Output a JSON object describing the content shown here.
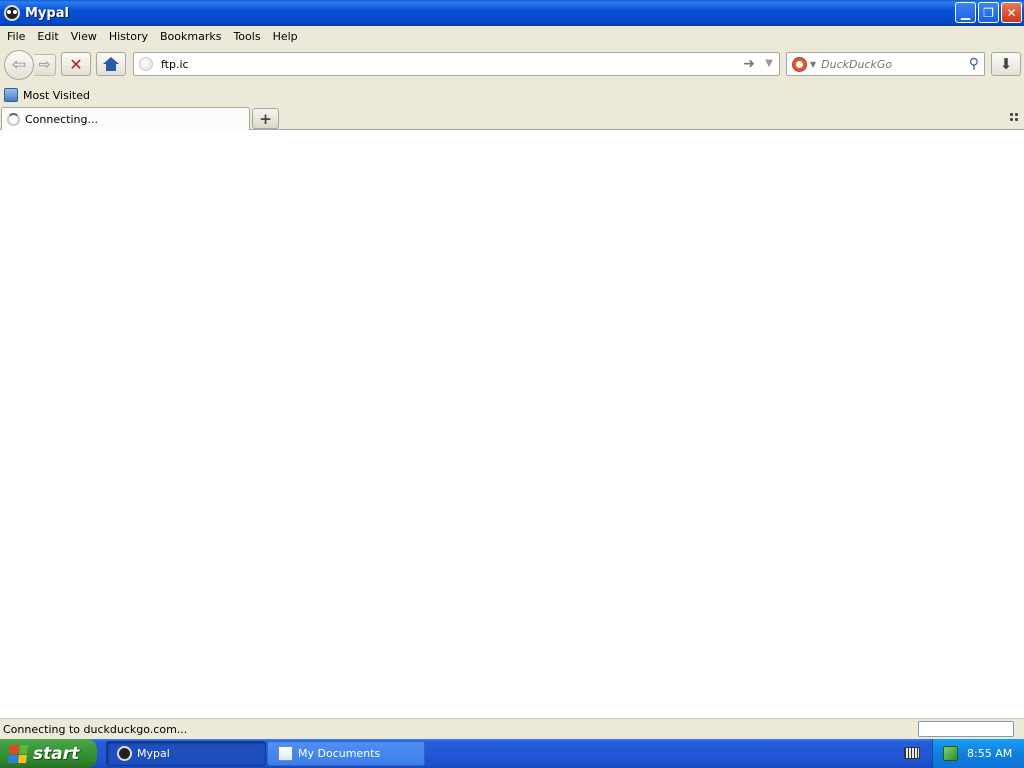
{
  "window": {
    "title": "Mypal",
    "controls": [
      "minimize",
      "restore",
      "close"
    ]
  },
  "menu": [
    "File",
    "Edit",
    "View",
    "History",
    "Bookmarks",
    "Tools",
    "Help"
  ],
  "toolbar": {
    "back_icon": "back-arrow-icon",
    "forward_icon": "forward-arrow-icon",
    "stop_label": "✕",
    "url_value": "ftp.ic",
    "search_placeholder": "DuckDuckGo"
  },
  "bookmarks": {
    "items": [
      "Most Visited"
    ]
  },
  "tabs": [
    {
      "label": "Connecting...",
      "state": "loading"
    }
  ],
  "status": {
    "text": "Connecting to duckduckgo.com..."
  },
  "taskbar": {
    "start_label": "start",
    "tasks": [
      "Mypal",
      "My Documents"
    ],
    "clock": "8:55 AM"
  },
  "colors": {
    "title_bar": "#0753d4",
    "chrome": "#ece9d8",
    "taskbar": "#245edb",
    "start_button": "#3b9b3b",
    "stop_icon": "#b22020"
  }
}
